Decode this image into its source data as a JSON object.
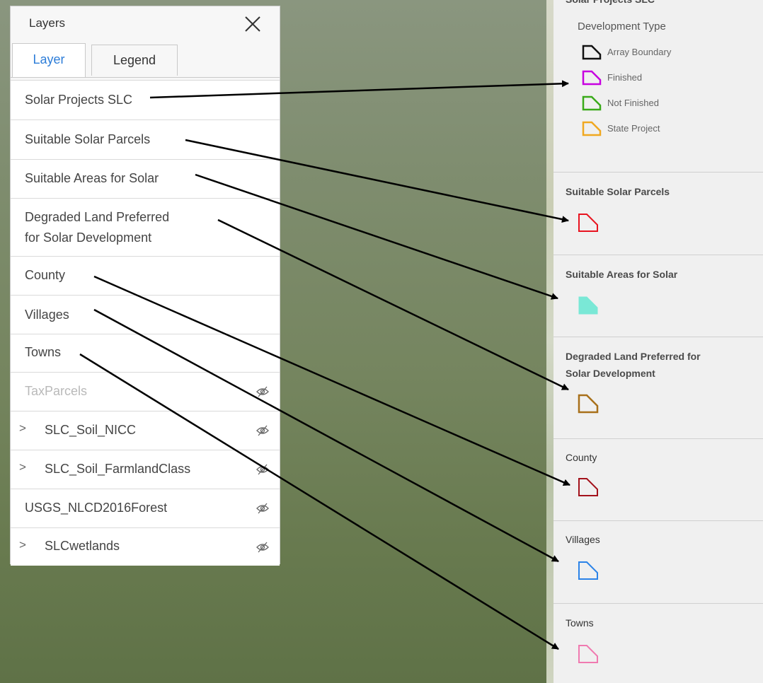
{
  "layers_panel": {
    "title": "Layers",
    "tabs": [
      "Layer",
      "Legend"
    ],
    "layers": [
      {
        "label": "Solar Projects SLC"
      },
      {
        "label": "Suitable Solar Parcels"
      },
      {
        "label": "Suitable Areas for Solar"
      },
      {
        "label": "Degraded Land Preferred for Solar Development"
      },
      {
        "label": "County"
      },
      {
        "label": "Villages"
      },
      {
        "label": "Towns"
      },
      {
        "label": "TaxParcels"
      },
      {
        "label": "SLC_Soil_NICC"
      },
      {
        "label": "SLC_Soil_FarmlandClass"
      },
      {
        "label": "USGS_NLCD2016Forest"
      },
      {
        "label": "SLCwetlands"
      }
    ],
    "line1": "Degraded Land Preferred",
    "line2": "for Solar Development",
    "expand_glyph": ">"
  },
  "legend_panel": {
    "top_title": "Solar Projects SLC",
    "development_type": "Development Type",
    "dev_items": [
      {
        "label": "Array Boundary",
        "color": "#111111"
      },
      {
        "label": "Finished",
        "color": "#c700e0"
      },
      {
        "label": "Not Finished",
        "color": "#3aaa1a"
      },
      {
        "label": "State Project",
        "color": "#f0a820"
      }
    ],
    "sections": [
      {
        "title": "Suitable Solar Parcels",
        "color": "#e8131f",
        "fill": "none"
      },
      {
        "title": "Suitable Areas for Solar",
        "color": "#7ae8d6",
        "fill": "#7ae8d6"
      },
      {
        "title_line1": "Degraded Land Preferred for",
        "title_line2": "Solar Development",
        "color": "#a8701a",
        "fill": "none"
      },
      {
        "title": "County",
        "color": "#a3121b",
        "fill": "none"
      },
      {
        "title": "Villages",
        "color": "#2b83e8",
        "fill": "none"
      },
      {
        "title": "Towns",
        "color": "#f07ab0",
        "fill": "none"
      }
    ]
  }
}
